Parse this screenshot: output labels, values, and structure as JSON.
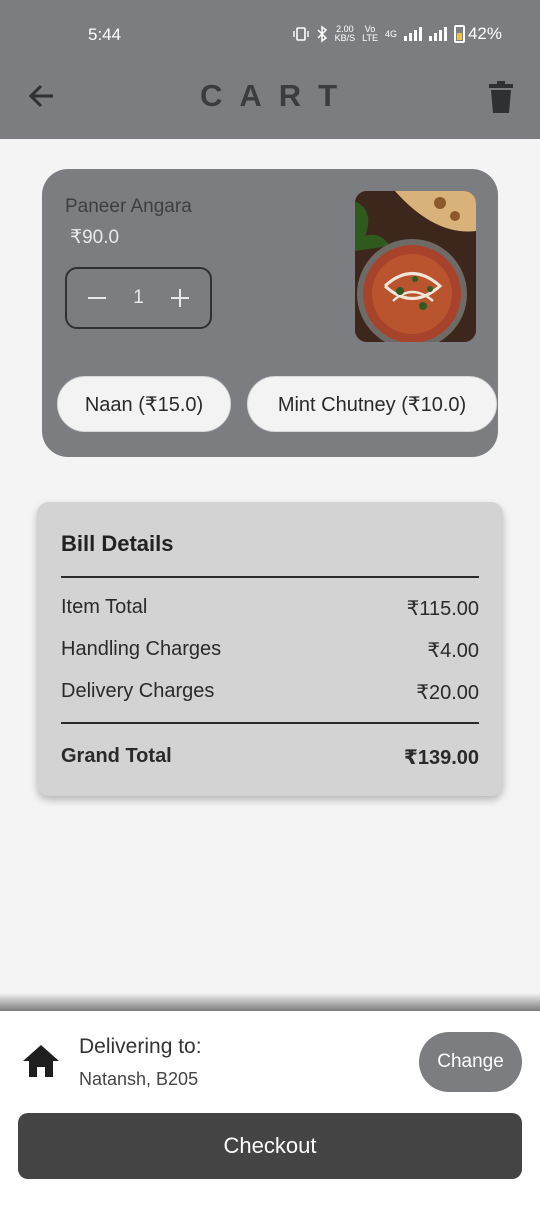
{
  "status_bar": {
    "time": "5:44",
    "speed_value": "2.00",
    "speed_unit": "KB/S",
    "volte_top": "Vo",
    "volte_bottom": "LTE",
    "network": "4G",
    "battery": "42%"
  },
  "app_bar": {
    "title": "CART",
    "back_icon": "arrow-back-icon",
    "delete_icon": "trash-icon"
  },
  "cart_item": {
    "name": "Paneer Angara",
    "price": "₹90.0",
    "quantity": "1",
    "decrement_icon": "minus-icon",
    "increment_icon": "plus-icon",
    "addons": [
      {
        "label": "Naan (₹15.0)"
      },
      {
        "label": "Mint Chutney (₹10.0)"
      }
    ]
  },
  "bill": {
    "title": "Bill Details",
    "rows": [
      {
        "label": "Item Total",
        "value": "₹115.00"
      },
      {
        "label": "Handling Charges",
        "value": "₹4.00"
      },
      {
        "label": "Delivery Charges",
        "value": "₹20.00"
      }
    ],
    "grand_total": {
      "label": "Grand Total",
      "value": "₹139.00"
    }
  },
  "delivery": {
    "icon": "home-icon",
    "title": "Delivering to:",
    "address": "Natansh, B205",
    "change_label": "Change"
  },
  "checkout": {
    "label": "Checkout"
  },
  "colors": {
    "accent_gray": "#7b7d80",
    "checkout_bg": "#444444",
    "bill_bg": "#d3d3d3",
    "page_bg": "#f4f4f4"
  }
}
